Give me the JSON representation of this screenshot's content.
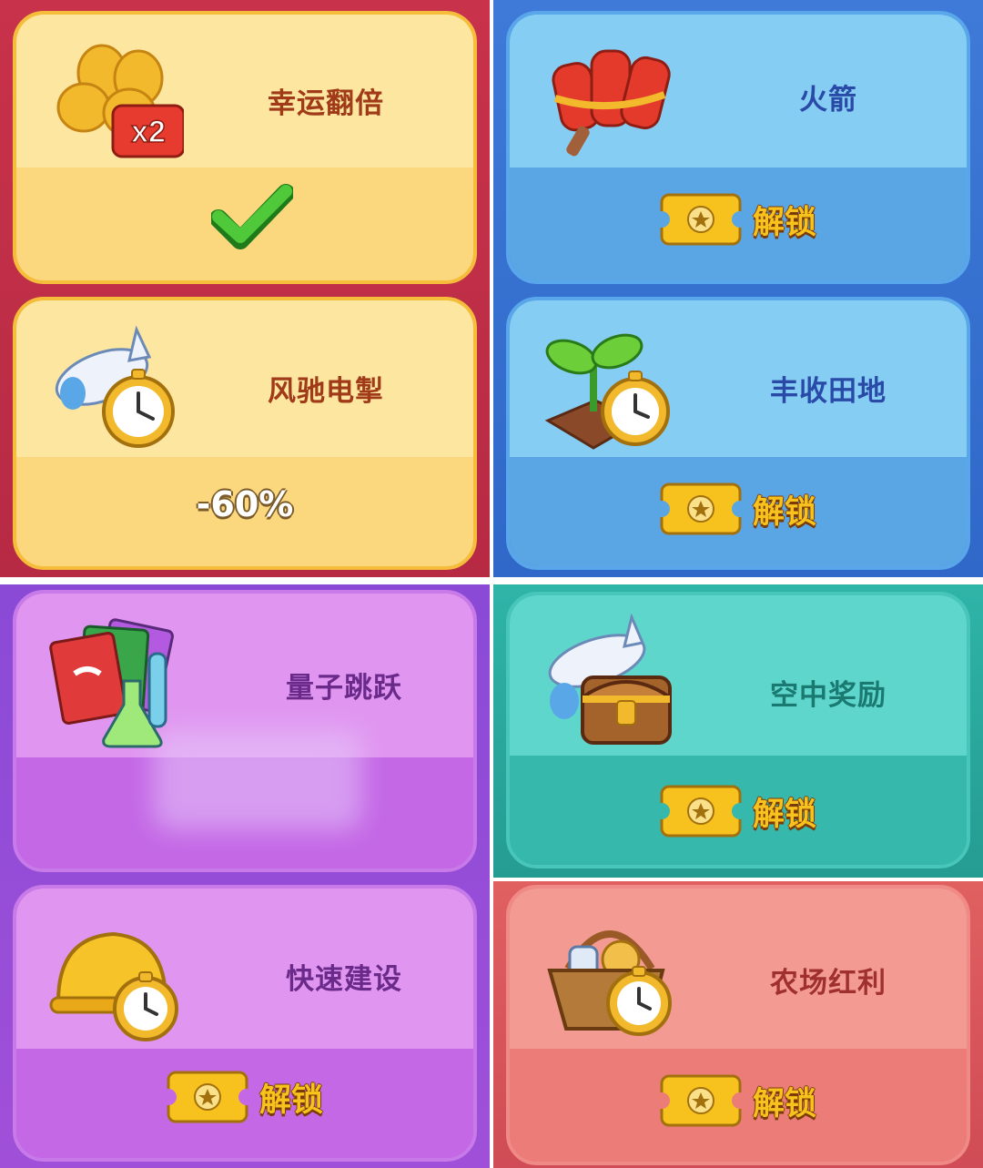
{
  "cards": [
    {
      "title": "幸运翻倍",
      "icon": "clover-x2-icon",
      "badge": "x2",
      "status": "active-check"
    },
    {
      "title": "风驰电掣",
      "icon": "plane-stopwatch-icon",
      "value": "-60%"
    },
    {
      "title": "火箭",
      "icon": "firecracker-rocket-icon",
      "action": "解锁"
    },
    {
      "title": "丰收田地",
      "icon": "sprout-stopwatch-icon",
      "action": "解锁"
    },
    {
      "title": "量子跳跃",
      "icon": "cards-flask-icon"
    },
    {
      "title": "空中奖励",
      "icon": "plane-chest-icon",
      "action": "解锁"
    },
    {
      "title": "快速建设",
      "icon": "hardhat-stopwatch-icon",
      "action": "解锁"
    },
    {
      "title": "农场红利",
      "icon": "basket-stopwatch-icon",
      "action": "解锁"
    }
  ],
  "colors": {
    "yellow_card": "#fce59a",
    "blue_card": "#86cdf3",
    "purple_card": "#d987ee",
    "teal_card": "#5fd6cb",
    "red_card": "#f39a92",
    "unlock_gold": "#f7c21e"
  }
}
